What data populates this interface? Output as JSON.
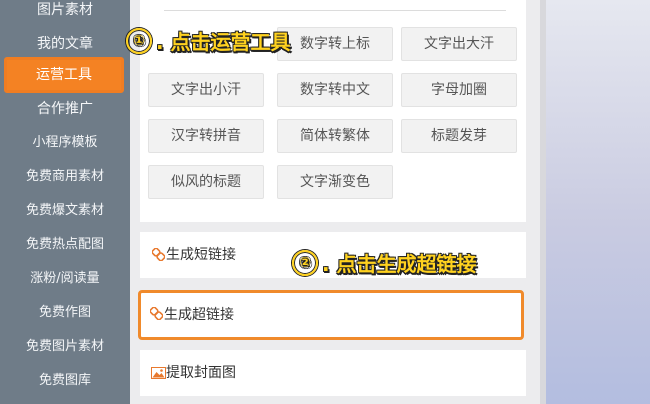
{
  "sidebar": {
    "items": [
      "图片素材",
      "我的文章",
      "运营工具",
      "合作推广",
      "小程序模板",
      "免费商用素材",
      "免费爆文素材",
      "免费热点配图",
      "涨粉/阅读量",
      "免费作图",
      "免费图片素材",
      "免费图库"
    ],
    "active_label": "运营工具"
  },
  "tools": {
    "buttons": [
      "数字转上标",
      "文字出大汗",
      "文字出小汗",
      "数字转中文",
      "字母加圈",
      "汉字转拼音",
      "简体转繁体",
      "标题发芽",
      "似风的标题",
      "文字渐变色"
    ]
  },
  "links": {
    "short_link": "生成短链接",
    "super_link": "生成超链接",
    "cover": "提取封面图"
  },
  "annotations": {
    "step1_num": "①",
    "step1_text": ". 点击运营工具",
    "step2_num": "②",
    "step2_text": ". 点击生成超链接"
  },
  "colors": {
    "sidebar_bg": "#6f7c88",
    "accent_orange": "#f48223",
    "callout_yellow": "#ffd21f"
  }
}
